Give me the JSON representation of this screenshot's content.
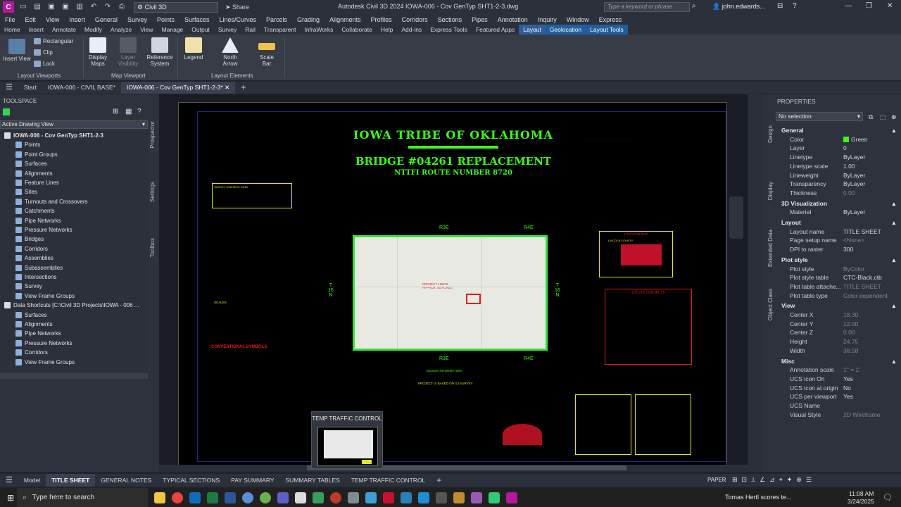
{
  "titlebar": {
    "logo": "C",
    "workspace": "Civil 3D",
    "share": "Share",
    "title": "Autodesk Civil 3D 2024   IOWA-006 - Cov GenTyp SHT1-2-3.dwg",
    "search_placeholder": "Type a keyword or phrase",
    "user": "john.edwards...",
    "minimize": "—",
    "restore": "❐",
    "close": "✕"
  },
  "menubar": [
    "File",
    "Edit",
    "View",
    "Insert",
    "General",
    "Survey",
    "Points",
    "Surfaces",
    "Lines/Curves",
    "Parcels",
    "Grading",
    "Alignments",
    "Profiles",
    "Corridors",
    "Sections",
    "Pipes",
    "Annotation",
    "Inquiry",
    "Window",
    "Express"
  ],
  "ribbon_tabs": [
    "Home",
    "Insert",
    "Annotate",
    "Modify",
    "Analyze",
    "View",
    "Manage",
    "Output",
    "Survey",
    "Rail",
    "Transparent",
    "InfraWorks",
    "Collaborate",
    "Help",
    "Add-ins",
    "Express Tools",
    "Featured Apps",
    "Layout",
    "Geolocation",
    "Layout Tools"
  ],
  "ribbon": {
    "insert_view": "Insert View",
    "rectangular": "Rectangular",
    "clip": "Clip",
    "lock": "Lock",
    "display_maps": "Display\nMaps",
    "layer_visibility": "Layer\nVisibility",
    "reference_system": "Reference\nSystem",
    "legend": "Legend",
    "north_arrow": "North\nArrow",
    "scale_bar": "Scale\nBar",
    "panel_viewports": "Layout Viewports",
    "panel_mapview": "Map Viewport",
    "panel_elements": "Layout Elements"
  },
  "doc_tabs": [
    "Start",
    "IOWA-006 - CIVIL BASE*",
    "IOWA-006 - Cov GenTyp SHT1-2-3*"
  ],
  "toolspace": {
    "title": "TOOLSPACE",
    "view": "Active Drawing View",
    "tabs": [
      "Prospector",
      "Settings",
      "Toolbox"
    ],
    "tree": [
      {
        "label": "IOWA-006 - Cov GenTyp SHT1-2-3",
        "level": 0,
        "bold": true
      },
      {
        "label": "Points",
        "level": 2
      },
      {
        "label": "Point Groups",
        "level": 2
      },
      {
        "label": "Surfaces",
        "level": 2
      },
      {
        "label": "Alignments",
        "level": 2
      },
      {
        "label": "Feature Lines",
        "level": 2
      },
      {
        "label": "Sites",
        "level": 2
      },
      {
        "label": "Turnouts and Crossovers",
        "level": 2
      },
      {
        "label": "Catchments",
        "level": 2
      },
      {
        "label": "Pipe Networks",
        "level": 2
      },
      {
        "label": "Pressure Networks",
        "level": 2
      },
      {
        "label": "Bridges",
        "level": 2
      },
      {
        "label": "Corridors",
        "level": 2
      },
      {
        "label": "Assemblies",
        "level": 2
      },
      {
        "label": "Subassemblies",
        "level": 2
      },
      {
        "label": "Intersections",
        "level": 2
      },
      {
        "label": "Survey",
        "level": 2
      },
      {
        "label": "View Frame Groups",
        "level": 2
      },
      {
        "label": "Data Shortcuts [C:\\Civil 3D Projects\\IOWA - 006 ...",
        "level": 0
      },
      {
        "label": "Surfaces",
        "level": 2
      },
      {
        "label": "Alignments",
        "level": 2
      },
      {
        "label": "Pipe Networks",
        "level": 2
      },
      {
        "label": "Pressure Networks",
        "level": 2
      },
      {
        "label": "Corridors",
        "level": 2
      },
      {
        "label": "View Frame Groups",
        "level": 2
      }
    ]
  },
  "drawing": {
    "title1": "IOWA TRIBE OF OKLAHOMA",
    "title2": "BRIDGE #04261 REPLACEMENT",
    "title3": "NTTFI ROUTE NUMBER 8720",
    "r3e": "R3E",
    "r4e": "R4E",
    "t16n": "T\n16\nN",
    "project_limits": "PROJECT LIMITS\nAPPROX. 40 ACRES",
    "location_map": "LOCATION MAP",
    "lincoln": "LINCOLN COUNTY",
    "conv_symbols": "CONVENTIONAL SYMBOLS",
    "utility": "UTILITY CONTACTS",
    "design_info": "DESIGN INFORMATION",
    "survey_note": "PROJECT IS BASED ON GJ SURVEY",
    "scales": "SCALES",
    "survey_control": "SURVEY CONTROL DATA"
  },
  "thumb": {
    "label": "TEMP TRAFFIC CONTROL"
  },
  "properties": {
    "title": "PROPERTIES",
    "selection": "No selection",
    "side_tabs": [
      "Design",
      "Display",
      "Extended Data",
      "Object Class"
    ],
    "sections": [
      {
        "name": "General",
        "rows": [
          [
            "Color",
            "Green"
          ],
          [
            "Layer",
            "0"
          ],
          [
            "Linetype",
            "ByLayer"
          ],
          [
            "Linetype scale",
            "1.00"
          ],
          [
            "Lineweight",
            "ByLayer"
          ],
          [
            "Transparency",
            "ByLayer"
          ],
          [
            "Thickness",
            "0.00"
          ]
        ]
      },
      {
        "name": "3D Visualization",
        "rows": [
          [
            "Material",
            "ByLayer"
          ]
        ]
      },
      {
        "name": "Layout",
        "rows": [
          [
            "Layout name",
            "TITLE SHEET"
          ],
          [
            "Page setup name",
            "<None>"
          ],
          [
            "DPI to raster",
            "300"
          ]
        ]
      },
      {
        "name": "Plot style",
        "rows": [
          [
            "Plot style",
            "ByColor"
          ],
          [
            "Plot style table",
            "CTC-Black.ctb"
          ],
          [
            "Plot table attache...",
            "TITLE SHEET"
          ],
          [
            "Plot table type",
            "Color dependent"
          ]
        ]
      },
      {
        "name": "View",
        "rows": [
          [
            "Center X",
            "18.30"
          ],
          [
            "Center Y",
            "12.00"
          ],
          [
            "Center Z",
            "0.00"
          ],
          [
            "Height",
            "24.75"
          ],
          [
            "Width",
            "38.58"
          ]
        ]
      },
      {
        "name": "Misc",
        "rows": [
          [
            "Annotation scale",
            "1\" = 1'"
          ],
          [
            "UCS icon On",
            "Yes"
          ],
          [
            "UCS icon at origin",
            "No"
          ],
          [
            "UCS per viewport",
            "Yes"
          ],
          [
            "UCS Name",
            ""
          ],
          [
            "Visual Style",
            "2D Wireframe"
          ]
        ]
      }
    ]
  },
  "layout_tabs": [
    "Model",
    "TITLE SHEET",
    "GENERAL NOTES",
    "TYPICAL SECTIONS",
    "PAY SUMMARY",
    "SUMMARY TABLES",
    "TEMP TRAFFIC CONTROL"
  ],
  "status": {
    "paper": "PAPER"
  },
  "taskbar": {
    "search": "Type here to search",
    "notification": "Tomas Hertl scores te...",
    "time": "11:08 AM",
    "date": "3/24/2025"
  },
  "colors": {
    "accent": "#2f5e9a",
    "green": "#39ff14",
    "red": "#e11b1b",
    "yellow": "#e6e619",
    "paper": "#000000"
  }
}
